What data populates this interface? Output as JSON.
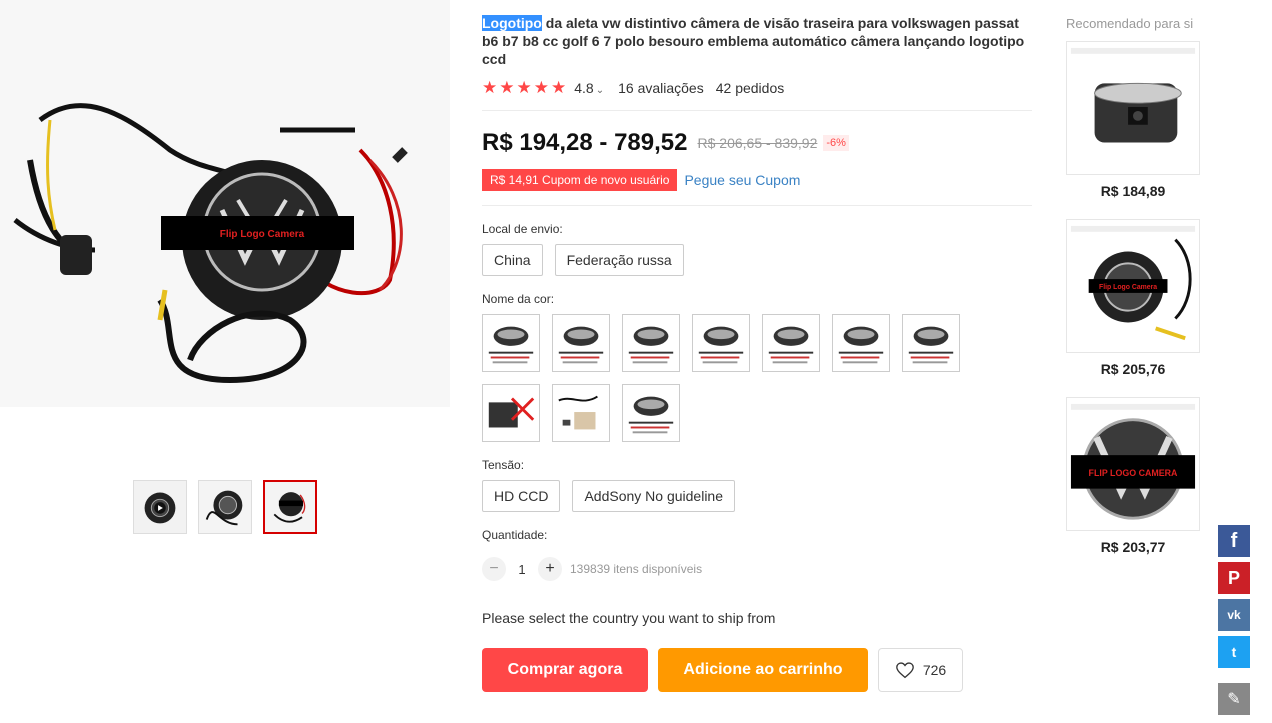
{
  "product": {
    "title_highlight": "Logotipo",
    "title_rest": " da aleta vw distintivo câmera de visão traseira para volkswagen passat b6 b7 b8 cc golf 6 7 polo besouro emblema automático câmera lançando logotipo ccd",
    "rating": "4.8",
    "reviews": "16 avaliações",
    "orders": "42 pedidos",
    "price": "R$ 194,28 - 789,52",
    "old_price": "R$ 206,65 - 839,92",
    "discount": "-6%",
    "coupon": "R$ 14,91 Cupom de novo usuário",
    "coupon_link": "Pegue seu Cupom",
    "main_image_label": "Flip Logo Camera"
  },
  "shipping": {
    "label": "Local de envio:",
    "options": [
      "China",
      "Federação russa"
    ]
  },
  "color": {
    "label": "Nome da cor:",
    "swatch_count": 10
  },
  "voltage": {
    "label": "Tensão:",
    "options": [
      "HD CCD",
      "AddSony No guideline"
    ]
  },
  "quantity": {
    "label": "Quantidade:",
    "minus": "−",
    "plus": "+",
    "value": "1",
    "available": "139839 itens disponíveis"
  },
  "ship_message": "Please select the country you want to ship from",
  "actions": {
    "buy": "Comprar agora",
    "cart": "Adicione ao carrinho",
    "wishlist_count": "726"
  },
  "recommended": {
    "title": "Recomendado para si",
    "items": [
      {
        "price": "R$ 184,89"
      },
      {
        "price": "R$ 205,76",
        "image_label": "Flip Logo Camera"
      },
      {
        "price": "R$ 203,77",
        "image_label": "FLIP LOGO CAMERA"
      }
    ]
  },
  "social": {
    "facebook": "f",
    "pinterest": "P",
    "vk": "vk",
    "twitter": "t"
  },
  "colors": {
    "accent_red": "#ff4747",
    "accent_orange": "#ff9900",
    "link_blue": "#3a82c4"
  }
}
